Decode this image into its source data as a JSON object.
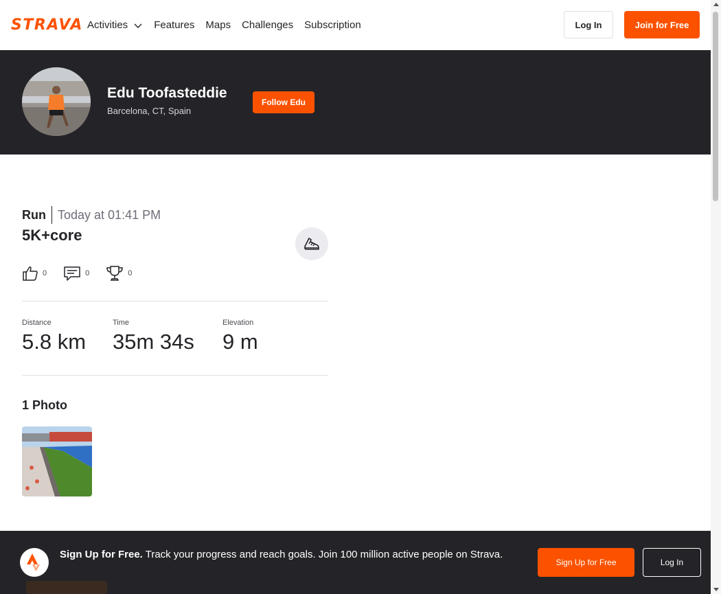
{
  "header": {
    "logo": "STRAVA",
    "nav": [
      {
        "label": "Activities",
        "has_dropdown": true
      },
      {
        "label": "Features"
      },
      {
        "label": "Maps"
      },
      {
        "label": "Challenges"
      },
      {
        "label": "Subscription"
      }
    ],
    "login_label": "Log In",
    "join_label": "Join for Free"
  },
  "athlete": {
    "name": "Edu Toofasteddie",
    "location": "Barcelona, CT, Spain",
    "follow_label": "Follow Edu"
  },
  "activity": {
    "type": "Run",
    "time": "Today at 01:41 PM",
    "title": "5K+core",
    "kudos": "0",
    "comments": "0",
    "achievements": "0",
    "stats": [
      {
        "label": "Distance",
        "value": "5.8 km"
      },
      {
        "label": "Time",
        "value": "35m 34s"
      },
      {
        "label": "Elevation",
        "value": "9 m"
      }
    ],
    "photos_title": "1 Photo"
  },
  "banner": {
    "lead": "Sign Up for Free.",
    "text": " Track your progress and reach goals. Join 100 million active people on Strava.",
    "signup_label": "Sign Up for Free",
    "login_label": "Log In"
  },
  "colors": {
    "brand": "#fc5200",
    "dark": "#242428"
  },
  "icons": {
    "activities_dropdown": "chevron-down-icon",
    "activity_type": "running-shoe-icon",
    "kudos": "thumbs-up-icon",
    "comments": "comment-icon",
    "achievements": "trophy-icon",
    "banner_logo": "strava-mark-icon"
  }
}
